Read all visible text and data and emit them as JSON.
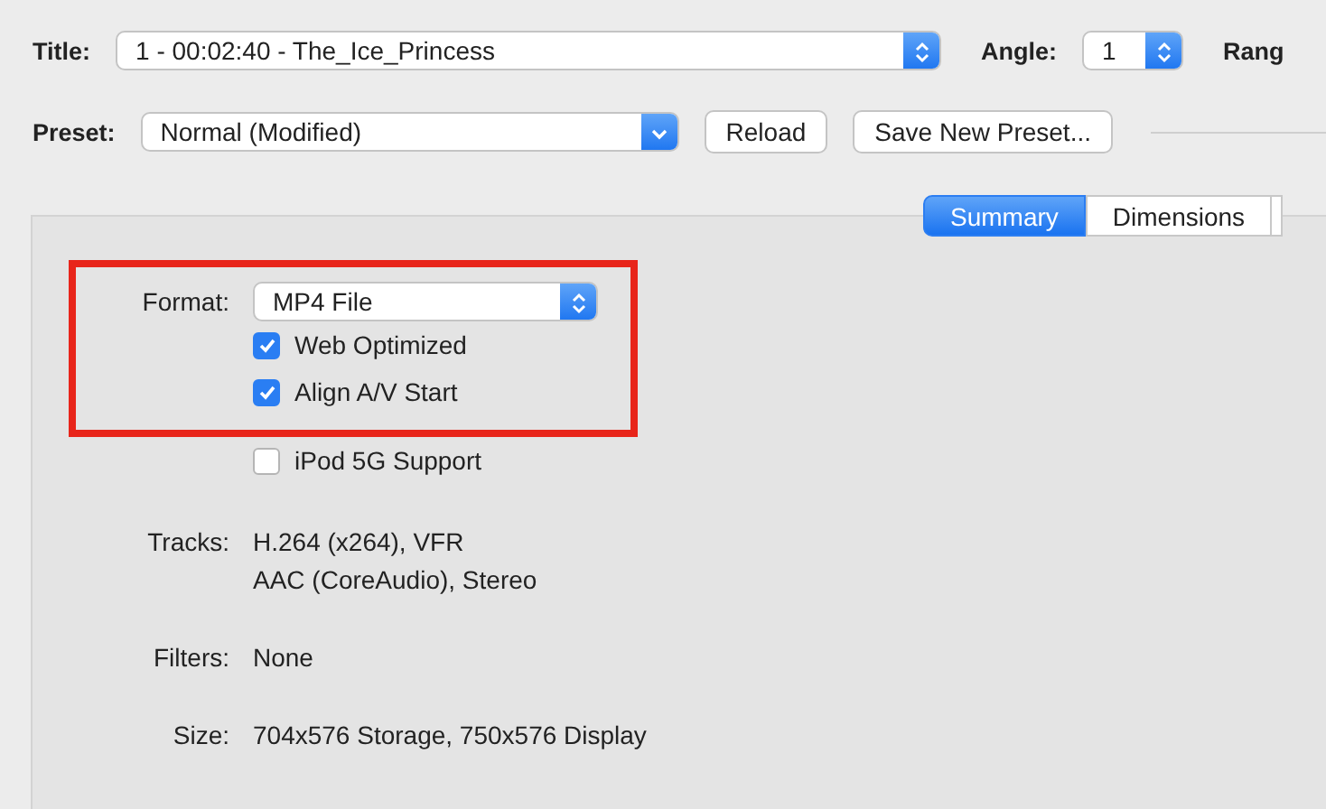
{
  "title_row": {
    "title_label": "Title:",
    "title_value": "1 - 00:02:40 - The_Ice_Princess",
    "angle_label": "Angle:",
    "angle_value": "1",
    "range_label": "Rang"
  },
  "preset_row": {
    "preset_label": "Preset:",
    "preset_value": "Normal (Modified)",
    "buttons": [
      "Reload",
      "Save New Preset..."
    ]
  },
  "tabs": [
    {
      "label": "Summary",
      "selected": true
    },
    {
      "label": "Dimensions",
      "selected": false
    }
  ],
  "format": {
    "label": "Format:",
    "value": "MP4 File",
    "highlighted": true
  },
  "options": [
    {
      "label": "Web Optimized",
      "checked": true,
      "highlighted": true
    },
    {
      "label": "Align A/V Start",
      "checked": true,
      "highlighted": true
    },
    {
      "label": "iPod 5G Support",
      "checked": false,
      "highlighted": false
    }
  ],
  "summary": [
    {
      "label": "Tracks:",
      "lines": [
        "H.264 (x264), VFR",
        "AAC (CoreAudio), Stereo"
      ]
    },
    {
      "label": "Filters:",
      "lines": [
        "None"
      ]
    },
    {
      "label": "Size:",
      "lines": [
        "704x576 Storage, 750x576 Display"
      ]
    }
  ]
}
